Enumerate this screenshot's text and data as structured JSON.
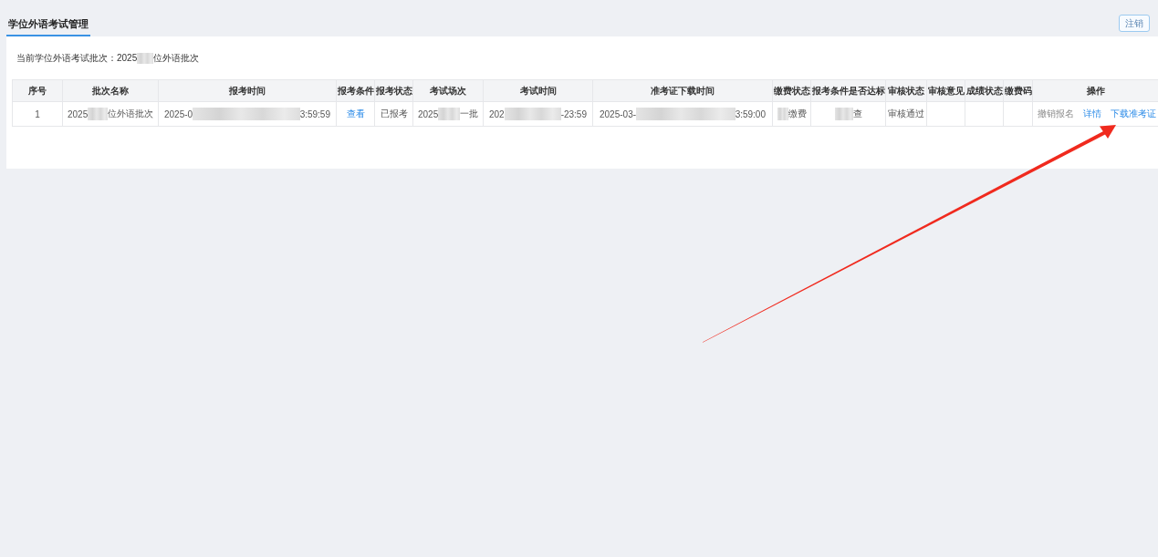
{
  "header": {
    "title": "学位外语考试管理",
    "logout_button": "注销"
  },
  "batch_info": {
    "parts": [
      {
        "kind": "text",
        "text": "当前学位外语考试批次：2025"
      },
      {
        "kind": "blur"
      },
      {
        "kind": "text",
        "text": "位外语批次"
      }
    ]
  },
  "table": {
    "columns": [
      "序号",
      "批次名称",
      "报考时间",
      "报考条件",
      "报考状态",
      "考试场次",
      "考试时间",
      "准考证下载时间",
      "缴费状态",
      "报考条件是否达标",
      "审核状态",
      "审核意见",
      "成绩状态",
      "缴费码",
      "操作"
    ],
    "rows": [
      {
        "cells": [
          {
            "kind": "text",
            "text": "1"
          },
          {
            "kind": "redacted",
            "parts": [
              {
                "kind": "text",
                "text": "2025"
              },
              {
                "kind": "blur"
              },
              {
                "kind": "text",
                "text": "位外语批次"
              }
            ]
          },
          {
            "kind": "redacted",
            "parts": [
              {
                "kind": "text",
                "text": "2025-0"
              },
              {
                "kind": "blur"
              },
              {
                "kind": "text",
                "text": "3:59:59"
              }
            ]
          },
          {
            "kind": "link",
            "text": "查看"
          },
          {
            "kind": "text",
            "text": "已报考"
          },
          {
            "kind": "redacted",
            "parts": [
              {
                "kind": "text",
                "text": "2025"
              },
              {
                "kind": "blur"
              },
              {
                "kind": "text",
                "text": "一批"
              }
            ]
          },
          {
            "kind": "redacted",
            "parts": [
              {
                "kind": "text",
                "text": "202"
              },
              {
                "kind": "blur"
              },
              {
                "kind": "text",
                "text": "-23:59"
              }
            ]
          },
          {
            "kind": "redacted",
            "parts": [
              {
                "kind": "text",
                "text": "2025-03-"
              },
              {
                "kind": "blur"
              },
              {
                "kind": "text",
                "text": "3:59:00"
              }
            ]
          },
          {
            "kind": "redacted",
            "parts": [
              {
                "kind": "blur"
              },
              {
                "kind": "text",
                "text": "缴费"
              }
            ]
          },
          {
            "kind": "redacted",
            "parts": [
              {
                "kind": "blur"
              },
              {
                "kind": "text",
                "text": "查"
              }
            ]
          },
          {
            "kind": "text",
            "text": "审核通过"
          },
          null,
          null,
          null,
          {
            "kind": "actions",
            "items": [
              {
                "label": "撤销报名",
                "disabled": true
              },
              {
                "label": "详情",
                "disabled": false
              },
              {
                "label": "下载准考证",
                "disabled": false
              }
            ]
          }
        ]
      }
    ]
  },
  "annotation": {
    "kind": "arrow"
  }
}
